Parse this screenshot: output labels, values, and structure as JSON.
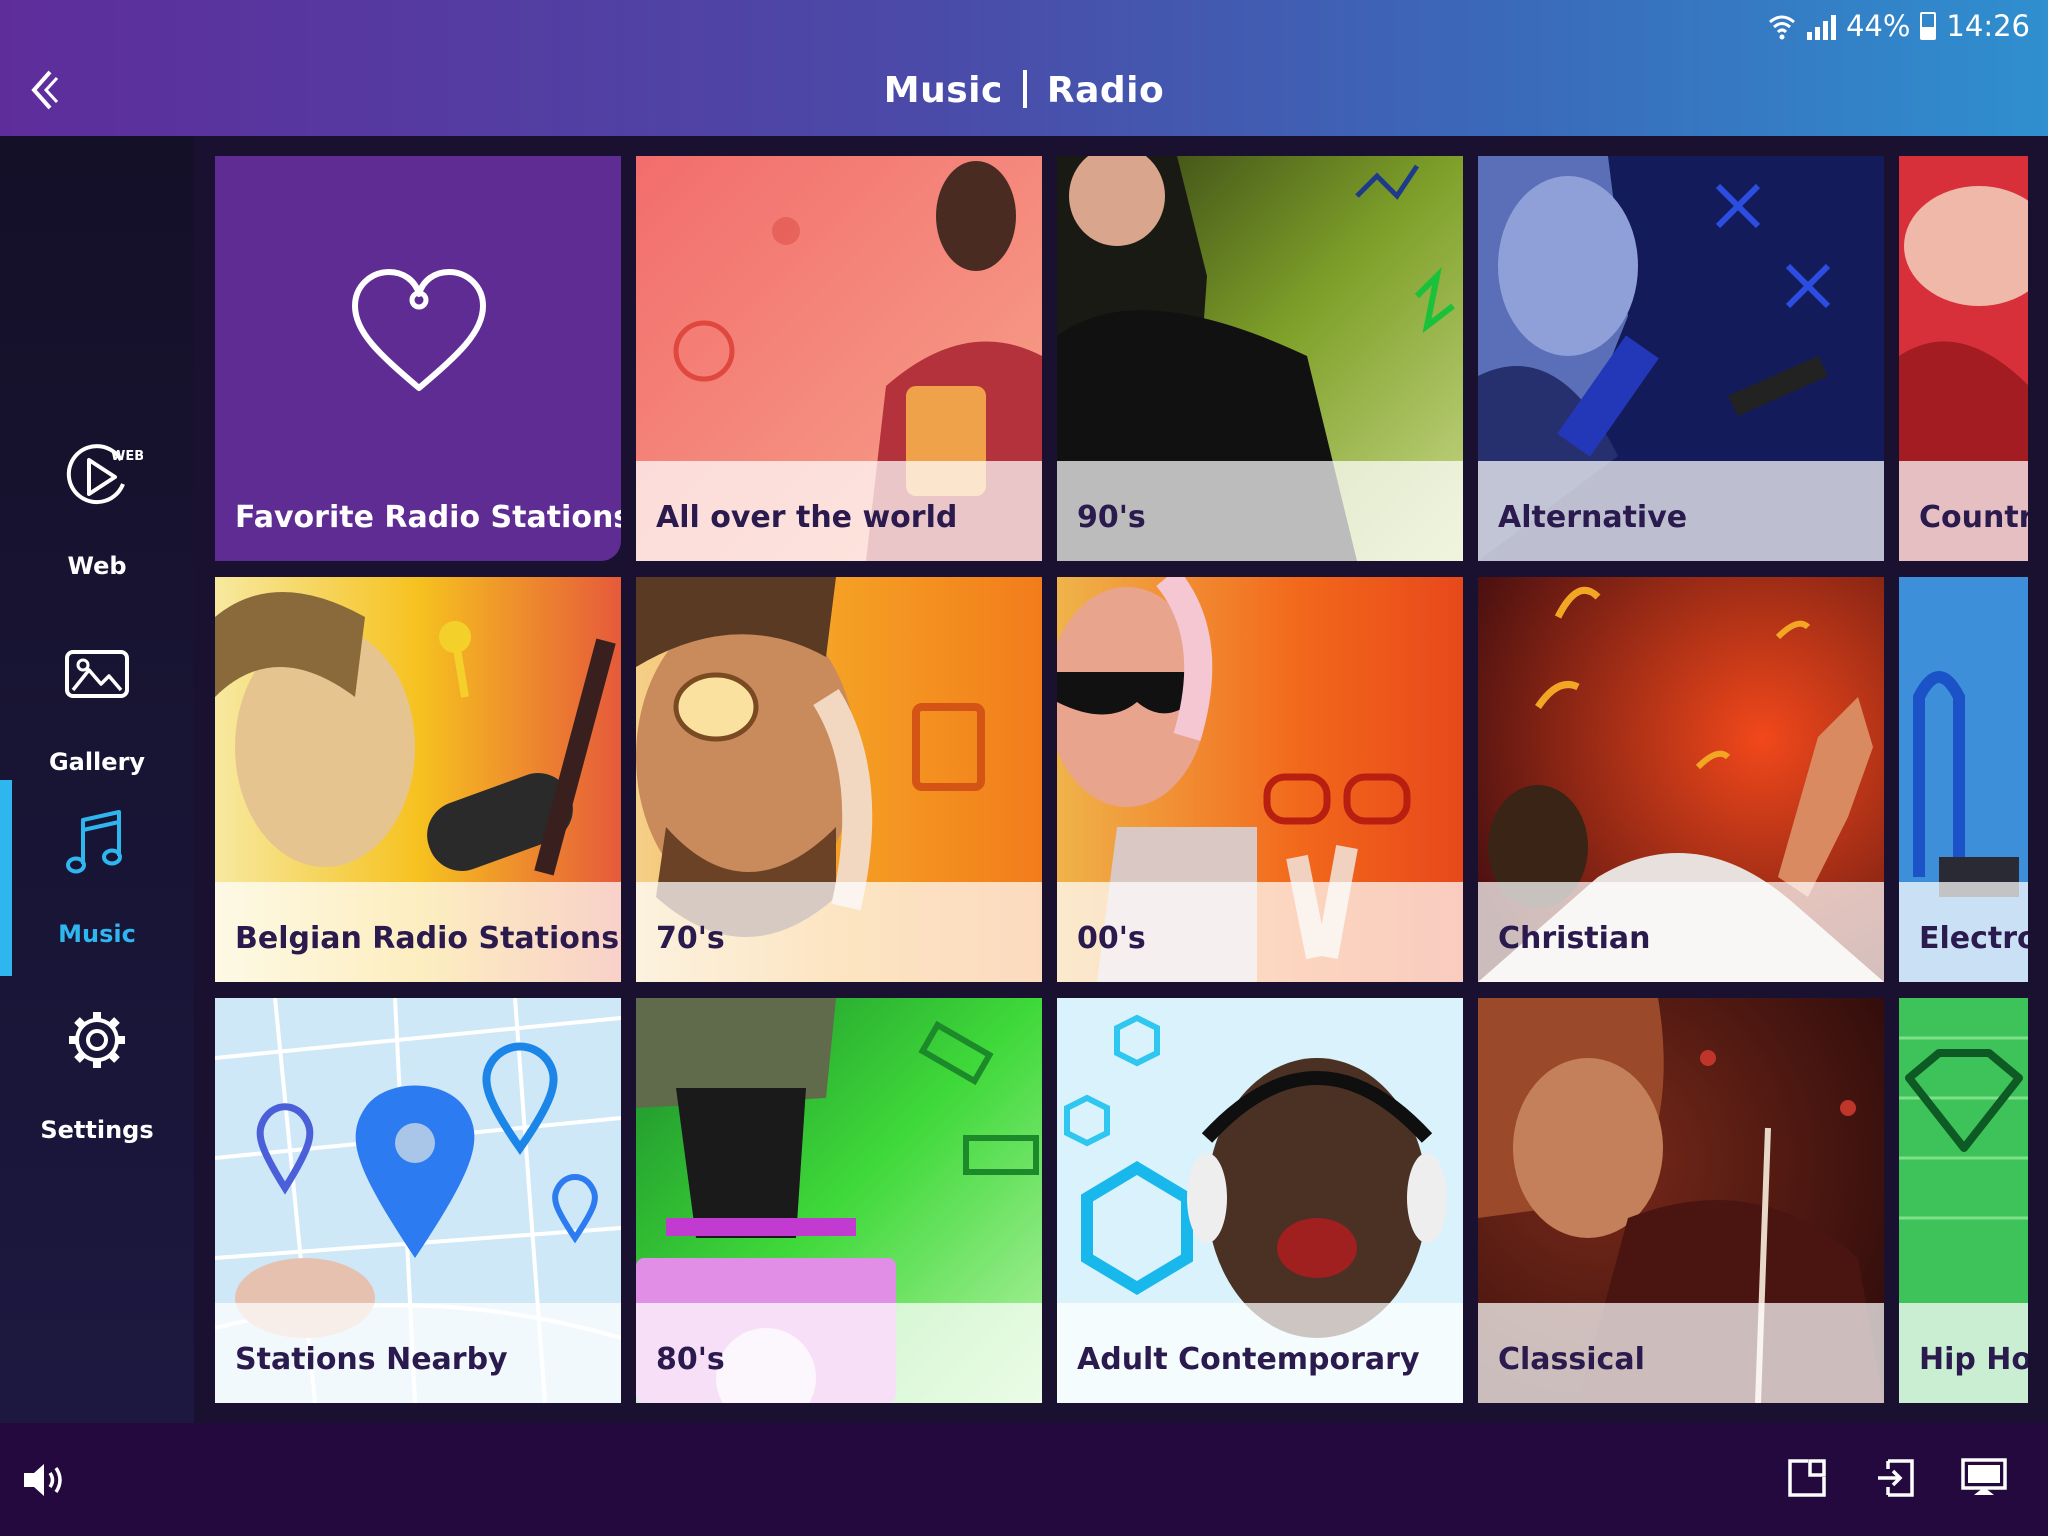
{
  "status_bar": {
    "battery": "44%",
    "time": "14:26"
  },
  "header": {
    "title_left": "Music",
    "title_right": "Radio"
  },
  "sidebar": {
    "items": [
      {
        "label": "Web",
        "icon": "web-play-icon",
        "badge": "WEB"
      },
      {
        "label": "Gallery",
        "icon": "gallery-icon"
      },
      {
        "label": "Music",
        "icon": "music-note-icon",
        "active": true
      },
      {
        "label": "Settings",
        "icon": "gear-icon"
      }
    ],
    "active_color": "#2fb6ee"
  },
  "tiles": [
    {
      "label": "Favorite Radio Stations"
    },
    {
      "label": "All over the world"
    },
    {
      "label": "90's"
    },
    {
      "label": "Alternative"
    },
    {
      "label": "Country"
    },
    {
      "label": "Belgian Radio Stations"
    },
    {
      "label": "70's"
    },
    {
      "label": "00's"
    },
    {
      "label": "Christian"
    },
    {
      "label": "Electronic"
    },
    {
      "label": "Stations Nearby"
    },
    {
      "label": "80's"
    },
    {
      "label": "Adult Contemporary"
    },
    {
      "label": "Classical"
    },
    {
      "label": "Hip Hop"
    }
  ],
  "bottom_bar": {
    "icons": [
      "volume-icon",
      "picture-in-picture-icon",
      "input-switch-icon",
      "screen-cast-icon"
    ]
  },
  "colors": {
    "header_gradient_start": "#5e2d9b",
    "header_gradient_end": "#2f8fcf",
    "favorite_tile": "#5f2c93",
    "tile_label": "#2b1a4e"
  }
}
